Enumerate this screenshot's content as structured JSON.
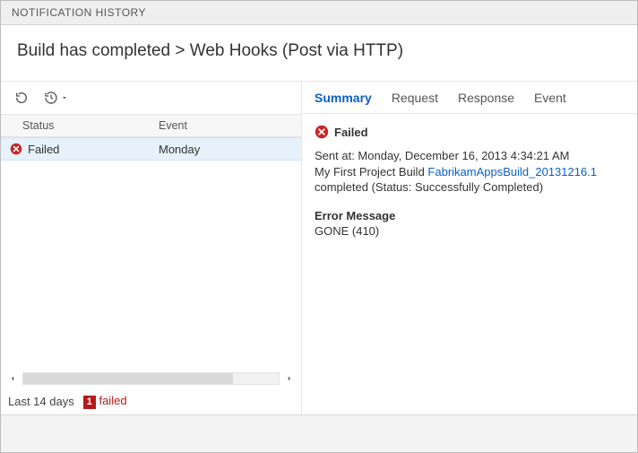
{
  "titlebar": "NOTIFICATION HISTORY",
  "heading": "Build has completed > Web Hooks (Post via HTTP)",
  "toolbar": {
    "refresh_tooltip": "Refresh",
    "history_tooltip": "History range"
  },
  "table": {
    "headers": {
      "status": "Status",
      "event": "Event"
    },
    "rows": [
      {
        "status": "Failed",
        "event": "Monday",
        "state": "error",
        "selected": true
      }
    ]
  },
  "statusbar": {
    "range": "Last 14 days",
    "failed_count": "1",
    "failed_label": "failed"
  },
  "tabs": [
    {
      "id": "summary",
      "label": "Summary",
      "active": true
    },
    {
      "id": "request",
      "label": "Request",
      "active": false
    },
    {
      "id": "response",
      "label": "Response",
      "active": false
    },
    {
      "id": "event",
      "label": "Event",
      "active": false
    }
  ],
  "detail": {
    "status_label": "Failed",
    "sent_prefix": "Sent at: ",
    "sent_at": "Monday, December 16, 2013 4:34:21 AM",
    "line2_pre": "My First Project Build ",
    "build_link": "FabrikamAppsBuild_20131216.1",
    "line2_post": " completed (Status: Successfully Completed)",
    "error_heading": "Error Message",
    "error_body": "GONE (410)"
  }
}
